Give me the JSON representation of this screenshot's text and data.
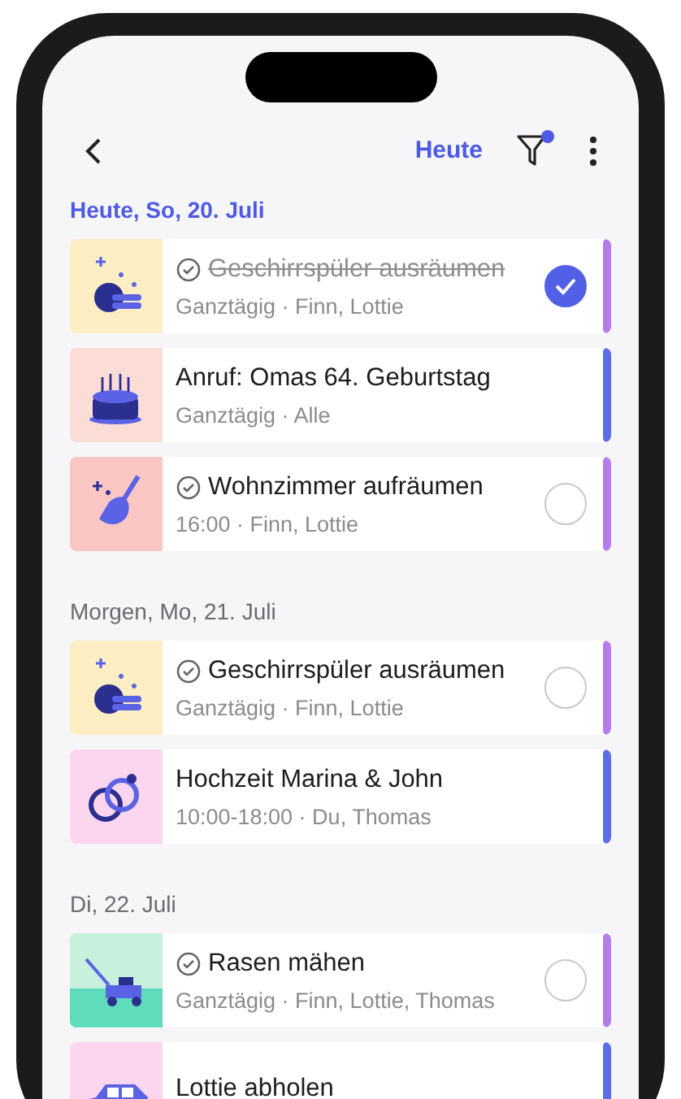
{
  "header": {
    "today_button": "Heute",
    "filter_active": true
  },
  "sections": [
    {
      "title": "Heute, So, 20. Juli",
      "highlighted": true,
      "items": [
        {
          "kind": "task",
          "title": "Geschirrspüler ausräumen",
          "details": "Ganztägig · Finn, Lottie",
          "checked": true,
          "color": "#b57cf0"
        },
        {
          "kind": "event",
          "title": "Anruf: Omas 64. Geburtstag",
          "details": "Ganztägig · Alle",
          "color": "#5b6ee8"
        },
        {
          "kind": "task",
          "title": "Wohnzimmer aufräumen",
          "details": "16:00 · Finn, Lottie",
          "checked": false,
          "color": "#b57cf0"
        }
      ]
    },
    {
      "title": "Morgen, Mo, 21. Juli",
      "highlighted": false,
      "items": [
        {
          "kind": "task",
          "title": "Geschirrspüler ausräumen",
          "details": "Ganztägig · Finn, Lottie",
          "checked": false,
          "color": "#b57cf0"
        },
        {
          "kind": "event",
          "title": "Hochzeit Marina & John",
          "details": "10:00-18:00 · Du, Thomas",
          "color": "#5b6ee8"
        }
      ]
    },
    {
      "title": "Di, 22. Juli",
      "highlighted": false,
      "items": [
        {
          "kind": "task",
          "title": "Rasen mähen",
          "details": "Ganztägig · Finn, Lottie, Thomas",
          "checked": false,
          "color": "#b57cf0"
        },
        {
          "kind": "event",
          "title": "Lottie abholen",
          "color": "#5b6ee8"
        }
      ]
    }
  ]
}
